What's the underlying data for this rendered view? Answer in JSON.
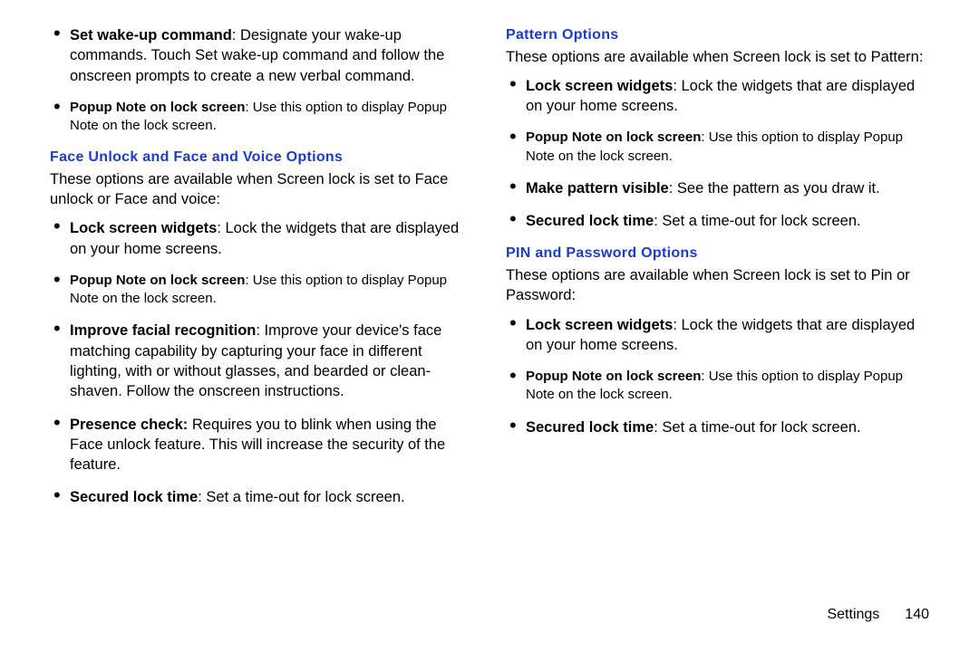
{
  "left": {
    "topBullets": [
      {
        "bold": "Set wake-up command",
        "text": ": Designate your wake-up commands. Touch Set wake-up command and follow the onscreen prompts to create a new verbal command.",
        "small": false
      },
      {
        "bold": "Popup Note on lock screen",
        "text": ": Use this option to display Popup Note on the lock screen.",
        "small": true
      }
    ],
    "section1": {
      "heading": "Face Unlock and Face and Voice Options",
      "intro": "These options are available when Screen lock is set to Face unlock or Face and voice:",
      "bullets": [
        {
          "bold": "Lock screen widgets",
          "text": ": Lock the widgets that are displayed on your home screens.",
          "small": false
        },
        {
          "bold": "Popup Note on lock screen",
          "text": ": Use this option to display Popup Note on the lock screen.",
          "small": true
        },
        {
          "bold": "Improve facial recognition",
          "text": ": Improve your device's face matching capability by capturing your face in different lighting, with or without glasses, and bearded or clean-shaven. Follow the onscreen instructions.",
          "small": false
        },
        {
          "bold": "Presence check:",
          "text": " Requires you to blink when using the Face unlock feature. This will increase the security of the feature.",
          "small": false
        },
        {
          "bold": "Secured lock time",
          "text": ": Set a time-out for lock screen.",
          "small": false
        }
      ]
    }
  },
  "right": {
    "section1": {
      "heading": "Pattern Options",
      "intro": "These options are available when Screen lock is set to Pattern:",
      "bullets": [
        {
          "bold": "Lock screen widgets",
          "text": ": Lock the widgets that are displayed on your home screens.",
          "small": false
        },
        {
          "bold": "Popup Note on lock screen",
          "text": ": Use this option to display Popup Note on the lock screen.",
          "small": true
        },
        {
          "bold": "Make pattern visible",
          "text": ": See the pattern as you draw it.",
          "small": false
        },
        {
          "bold": "Secured lock time",
          "text": ": Set a time-out for lock screen.",
          "small": false
        }
      ]
    },
    "section2": {
      "heading": "PIN and Password Options",
      "intro": "These options are available when Screen lock is set to Pin or Password:",
      "bullets": [
        {
          "bold": "Lock screen widgets",
          "text": ": Lock the widgets that are displayed on your home screens.",
          "small": false
        },
        {
          "bold": "Popup Note on lock screen",
          "text": ": Use this option to display Popup Note on the lock screen.",
          "small": true
        },
        {
          "bold": "Secured lock time",
          "text": ": Set a time-out for lock screen.",
          "small": false
        }
      ]
    }
  },
  "footer": {
    "section": "Settings",
    "page": "140"
  }
}
